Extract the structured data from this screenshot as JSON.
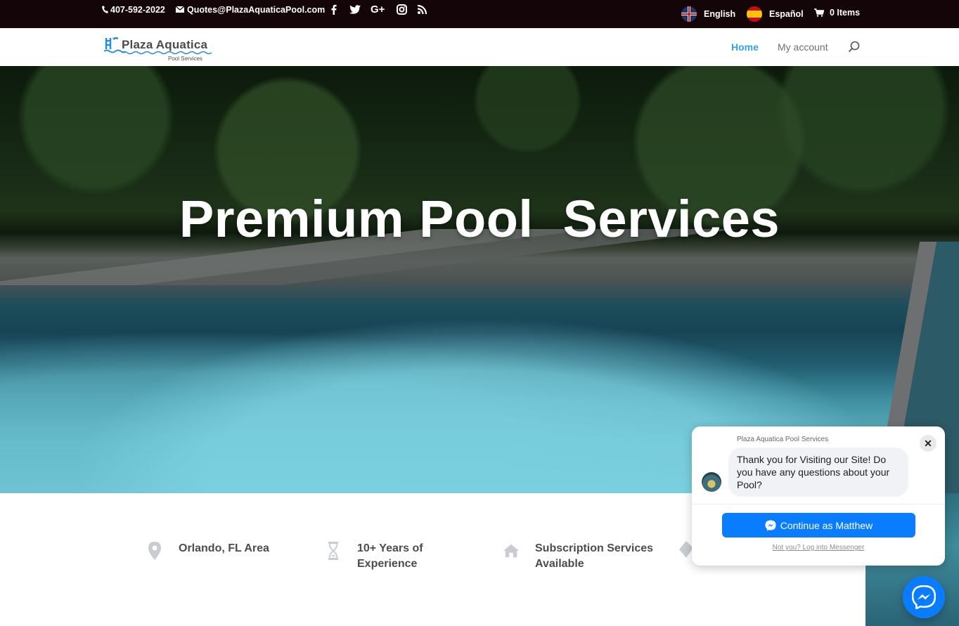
{
  "topbar": {
    "phone": "407-592-2022",
    "email": "Quotes@PlazaAquaticaPool.com",
    "social": [
      "facebook-icon",
      "twitter-icon",
      "google-plus-icon",
      "instagram-icon",
      "rss-icon"
    ],
    "lang_english": "English",
    "lang_spanish": "Español",
    "cart": "0 Items"
  },
  "logo": {
    "name": "Plaza Aquatica",
    "sub": "Pool Services"
  },
  "nav": {
    "home": "Home",
    "account": "My account"
  },
  "hero": {
    "title": "Premium Pool  Services"
  },
  "features": [
    {
      "icon": "map-pin-icon",
      "text": "Orlando, FL Area"
    },
    {
      "icon": "hourglass-icon",
      "text": "10+ Years of Experience"
    },
    {
      "icon": "home-icon",
      "text": "Subscription Services Available"
    }
  ],
  "chat": {
    "page_name": "Plaza Aquatica Pool Services",
    "message": "Thank you for Visiting our Site! Do you have any questions about your Pool?",
    "continue_label": "Continue as Matthew",
    "not_you": "Not you? Log into Messenger",
    "close": "✕"
  },
  "colors": {
    "accent": "#2ea3f2",
    "topbar": "#140608",
    "messenger": "#0a7cff"
  }
}
